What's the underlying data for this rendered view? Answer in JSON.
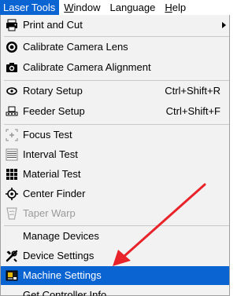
{
  "menubar": {
    "items": [
      {
        "label": "Laser Tools",
        "active": true
      },
      {
        "label": "Window",
        "underline": "W",
        "rest": "indow"
      },
      {
        "label": "Language"
      },
      {
        "label": "Help",
        "underline": "H",
        "rest": "elp"
      }
    ]
  },
  "menu": {
    "print_and_cut": {
      "label": "Print and Cut",
      "icon": "print-and-cut-icon"
    },
    "calibrate_camera_lens": {
      "label": "Calibrate Camera Lens",
      "icon": "camera-lens-icon"
    },
    "calibrate_camera_alignment": {
      "label": "Calibrate Camera Alignment",
      "icon": "camera-icon"
    },
    "rotary_setup": {
      "label": "Rotary Setup",
      "shortcut": "Ctrl+Shift+R",
      "icon": "rotary-icon"
    },
    "feeder_setup": {
      "label": "Feeder Setup",
      "shortcut": "Ctrl+Shift+F",
      "icon": "feeder-icon"
    },
    "focus_test": {
      "label": "Focus Test",
      "icon": "focus-test-icon"
    },
    "interval_test": {
      "label": "Interval Test",
      "icon": "interval-test-icon"
    },
    "material_test": {
      "label": "Material Test",
      "icon": "grid-icon"
    },
    "center_finder": {
      "label": "Center Finder",
      "icon": "crosshair-icon"
    },
    "taper_warp": {
      "label": "Taper Warp",
      "icon": "cup-icon",
      "disabled": true
    },
    "manage_devices": {
      "label": "Manage Devices"
    },
    "device_settings": {
      "label": "Device Settings",
      "icon": "wrench-icon"
    },
    "machine_settings": {
      "label": "Machine Settings",
      "icon": "machine-icon",
      "selected": true
    },
    "get_controller_info": {
      "label": "Get Controller Info"
    }
  },
  "colors": {
    "highlight": "#0a64d2",
    "menu_background": "#f2f2f2",
    "annotation_arrow": "#e8232a"
  }
}
